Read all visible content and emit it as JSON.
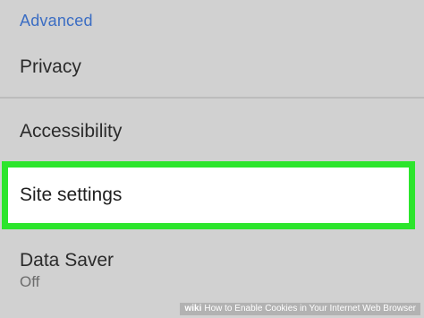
{
  "section": {
    "header": "Advanced"
  },
  "items": [
    {
      "label": "Privacy"
    },
    {
      "label": "Accessibility"
    },
    {
      "label": "Site settings"
    },
    {
      "label": "Data Saver",
      "value": "Off"
    }
  ],
  "highlight_color": "#2ce52c",
  "header_color": "#3b6dc3",
  "watermark": {
    "brand": "wiki",
    "text": "How to Enable Cookies in Your Internet Web Browser"
  }
}
